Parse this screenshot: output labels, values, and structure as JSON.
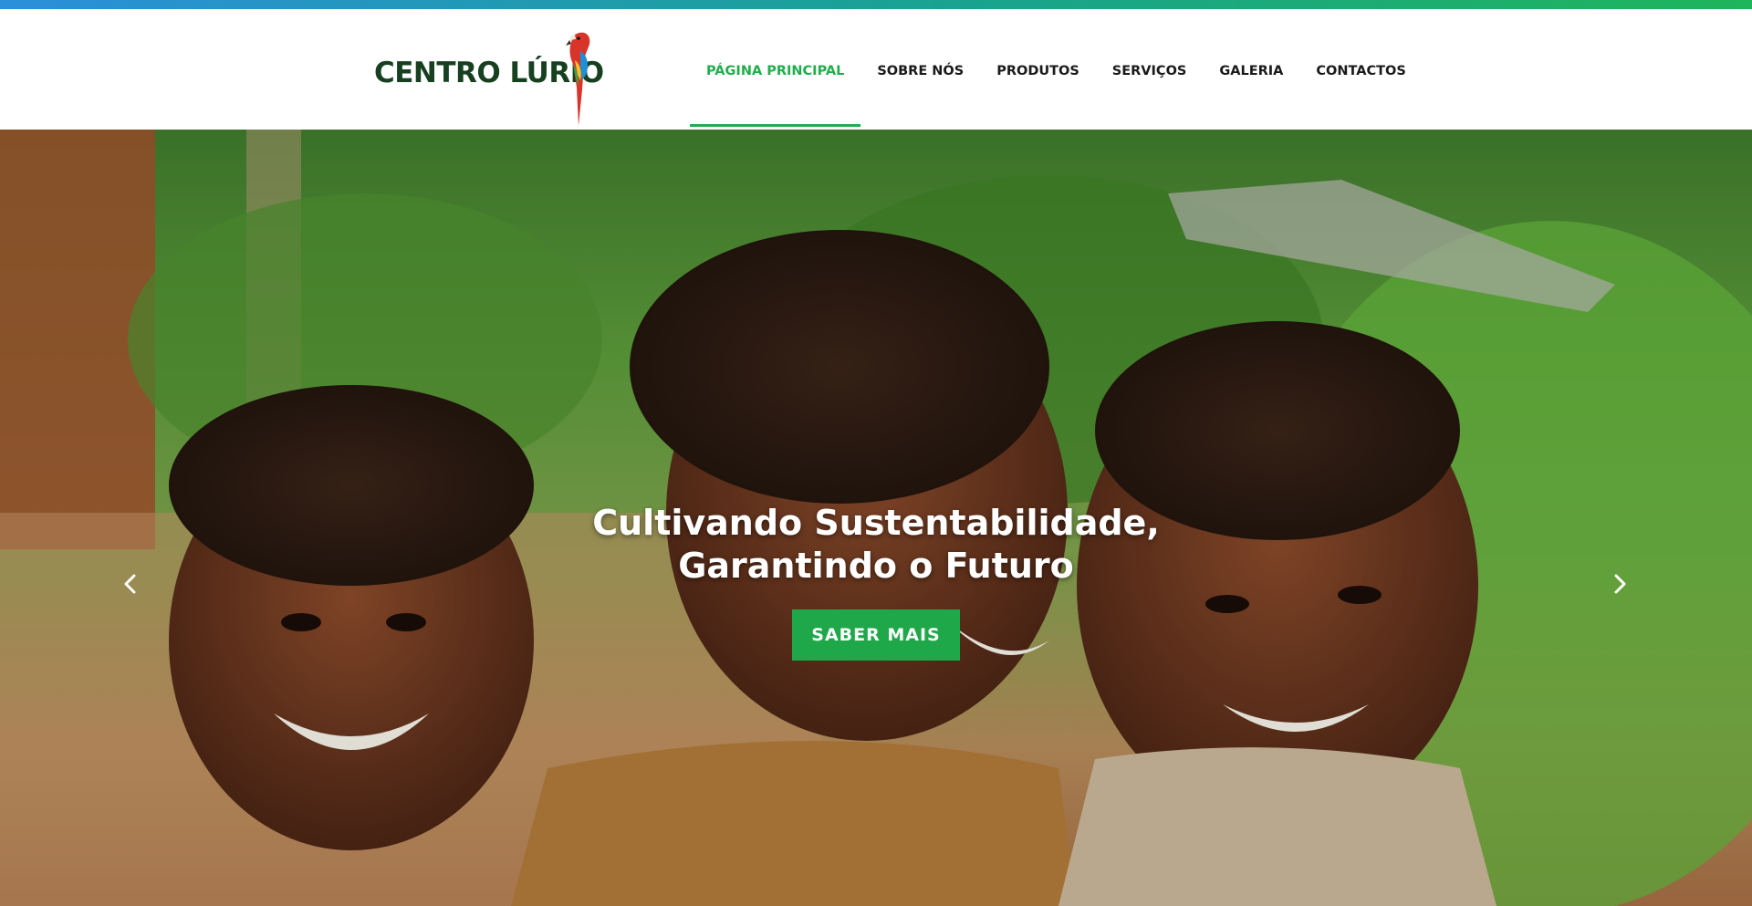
{
  "brand": {
    "name": "CENTRO LÚRIO",
    "colors": {
      "primary_green": "#1fae4b",
      "dark_green": "#16401f",
      "accent_blue": "#2b8fdb"
    }
  },
  "nav": {
    "items": [
      {
        "label": "PÁGINA PRINCIPAL",
        "active": true
      },
      {
        "label": "SOBRE NÓS",
        "active": false
      },
      {
        "label": "PRODUTOS",
        "active": false
      },
      {
        "label": "SERVIÇOS",
        "active": false
      },
      {
        "label": "GALERIA",
        "active": false
      },
      {
        "label": "CONTACTOS",
        "active": false
      }
    ]
  },
  "hero": {
    "title_line1": "Cultivando Sustentabilidade,",
    "title_line2": "Garantindo o Futuro",
    "cta_label": "SABER MAIS",
    "prev_icon": "chevron-left-icon",
    "next_icon": "chevron-right-icon"
  }
}
